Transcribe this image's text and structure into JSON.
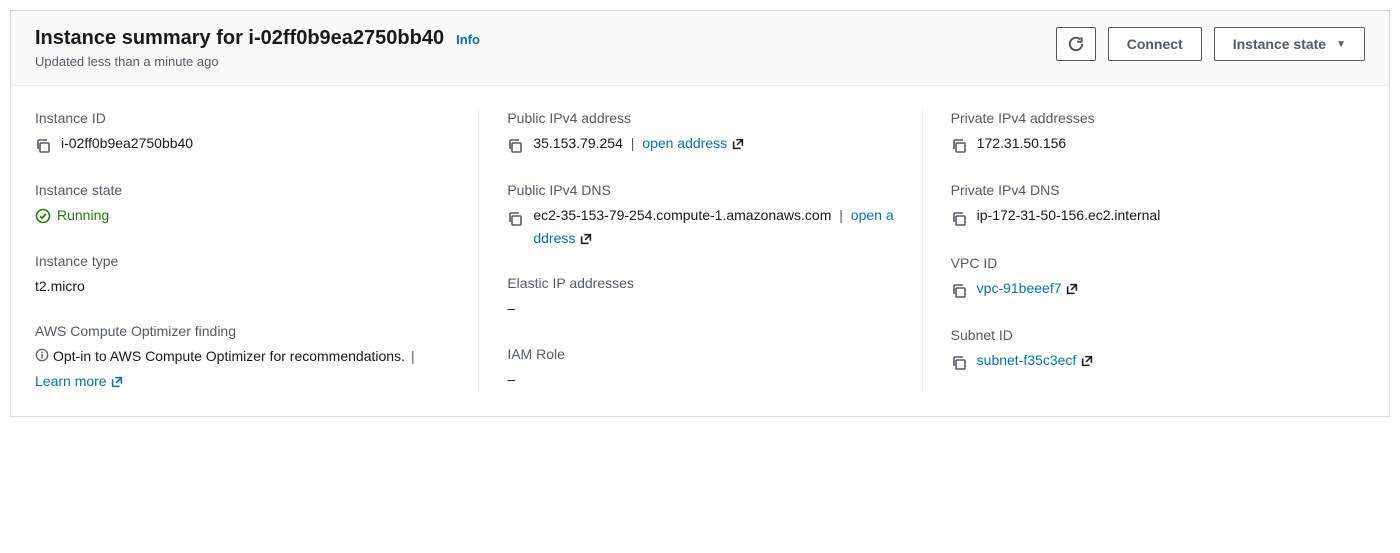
{
  "header": {
    "title": "Instance summary for i-02ff0b9ea2750bb40",
    "info_label": "Info",
    "updated": "Updated less than a minute ago",
    "connect_label": "Connect",
    "instance_state_label": "Instance state"
  },
  "col1": {
    "instance_id_label": "Instance ID",
    "instance_id": "i-02ff0b9ea2750bb40",
    "instance_state_label": "Instance state",
    "instance_state": "Running",
    "instance_type_label": "Instance type",
    "instance_type": "t2.micro",
    "optimizer_label": "AWS Compute Optimizer finding",
    "optimizer_text": "Opt-in to AWS Compute Optimizer for recommendations.",
    "learn_more": "Learn more"
  },
  "col2": {
    "pub_ip_label": "Public IPv4 address",
    "pub_ip": "35.153.79.254",
    "open_address": "open address",
    "pub_dns_label": "Public IPv4 DNS",
    "pub_dns": "ec2-35-153-79-254.compute-1.amazonaws.com",
    "eip_label": "Elastic IP addresses",
    "eip_value": "–",
    "iam_label": "IAM Role",
    "iam_value": "–"
  },
  "col3": {
    "priv_ip_label": "Private IPv4 addresses",
    "priv_ip": "172.31.50.156",
    "priv_dns_label": "Private IPv4 DNS",
    "priv_dns": "ip-172-31-50-156.ec2.internal",
    "vpc_label": "VPC ID",
    "vpc_id": "vpc-91beeef7",
    "subnet_label": "Subnet ID",
    "subnet_id": "subnet-f35c3ecf"
  }
}
